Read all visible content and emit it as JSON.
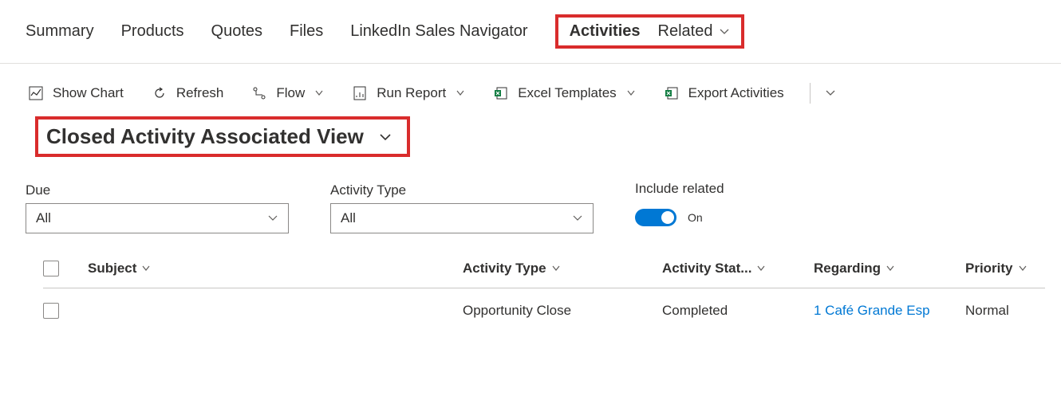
{
  "tabs": {
    "summary": "Summary",
    "products": "Products",
    "quotes": "Quotes",
    "files": "Files",
    "linkedin": "LinkedIn Sales Navigator",
    "activities": "Activities",
    "related": "Related"
  },
  "toolbar": {
    "show_chart": "Show Chart",
    "refresh": "Refresh",
    "flow": "Flow",
    "run_report": "Run Report",
    "excel_templates": "Excel Templates",
    "export_activities": "Export Activities"
  },
  "view": {
    "title": "Closed Activity Associated View"
  },
  "filters": {
    "due_label": "Due",
    "due_value": "All",
    "type_label": "Activity Type",
    "type_value": "All",
    "include_related_label": "Include related",
    "toggle_state": "On"
  },
  "table": {
    "headers": {
      "subject": "Subject",
      "activity_type": "Activity Type",
      "activity_status": "Activity Stat...",
      "regarding": "Regarding",
      "priority": "Priority"
    },
    "rows": [
      {
        "subject": "",
        "activity_type": "Opportunity Close",
        "activity_status": "Completed",
        "regarding": "1 Café Grande Esp",
        "priority": "Normal"
      }
    ]
  }
}
